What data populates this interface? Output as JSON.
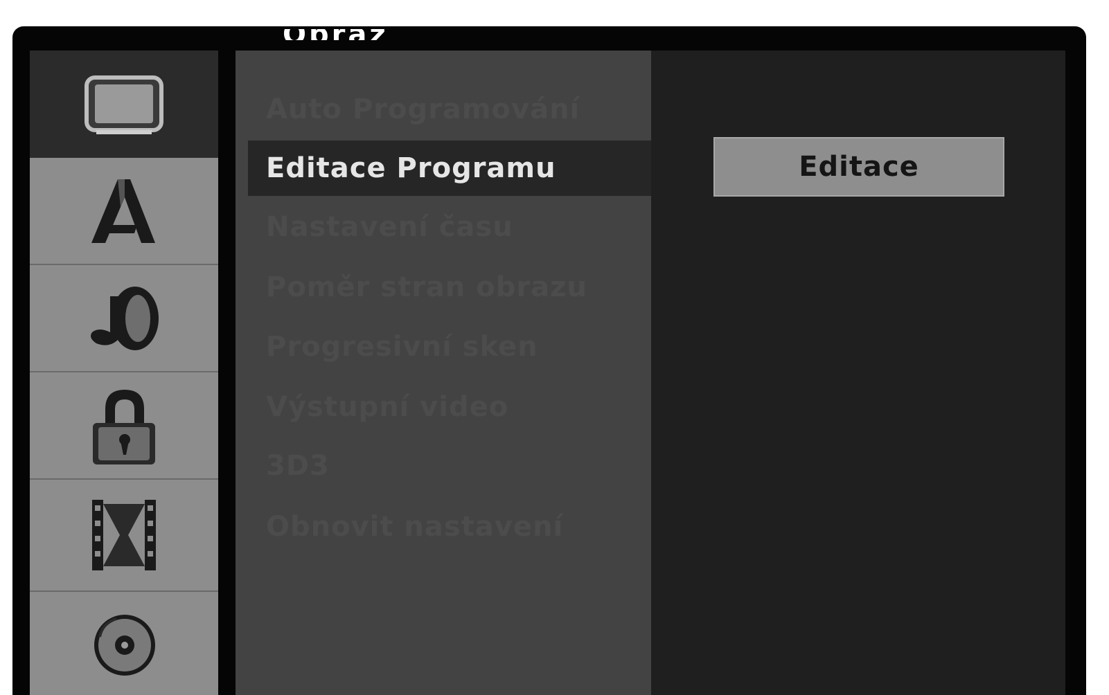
{
  "screen": {
    "title_fragment": "Obraz"
  },
  "icons": [
    {
      "name": "tv-icon",
      "selected": true
    },
    {
      "name": "language-icon",
      "selected": false
    },
    {
      "name": "audio-icon",
      "selected": false
    },
    {
      "name": "lock-icon",
      "selected": false
    },
    {
      "name": "film-icon",
      "selected": false
    },
    {
      "name": "disc-icon",
      "selected": false
    }
  ],
  "menu": {
    "items": [
      {
        "label": "Auto Programování",
        "selected": false
      },
      {
        "label": "Editace Programu",
        "selected": true
      },
      {
        "label": "Nastavení času",
        "selected": false
      },
      {
        "label": "Poměr stran obrazu",
        "selected": false
      },
      {
        "label": "Progresivní sken",
        "selected": false
      },
      {
        "label": "Výstupní video",
        "selected": false
      },
      {
        "label": "3D3",
        "selected": false
      },
      {
        "label": "Obnovit nastavení",
        "selected": false
      }
    ]
  },
  "option": {
    "button_label": "Editace"
  },
  "colors": {
    "frame": "#050505",
    "icon_panel": "#8d8d8d",
    "menu_panel": "#434343",
    "option_panel": "#1f1f1f",
    "highlight": "#262626",
    "button": "#8e8e8e"
  }
}
